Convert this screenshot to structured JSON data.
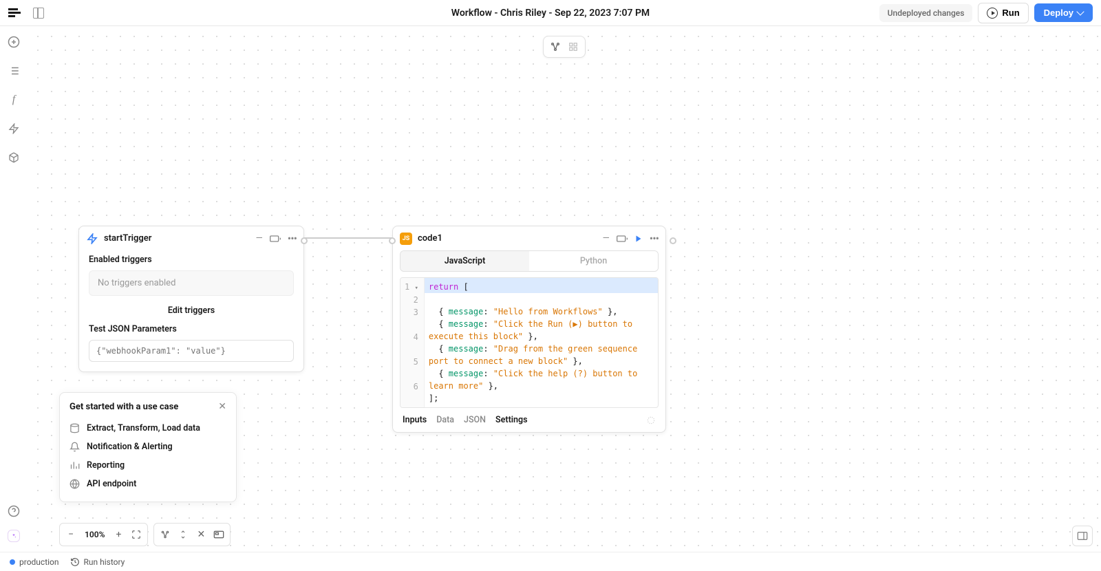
{
  "header": {
    "title": "Workflow - Chris Riley - Sep 22, 2023 7:07 PM",
    "undeployed": "Undeployed changes",
    "run": "Run",
    "deploy": "Deploy"
  },
  "triggerNode": {
    "title": "startTrigger",
    "enabled_label": "Enabled triggers",
    "no_triggers": "No triggers enabled",
    "edit": "Edit triggers",
    "params_label": "Test JSON Parameters",
    "params_placeholder": "{\"webhookParam1\": \"value\"}"
  },
  "codeNode": {
    "title": "code1",
    "tabs": {
      "js": "JavaScript",
      "py": "Python"
    },
    "code_lines": [
      "return [",
      "  { message: \"Hello from Workflows\" },",
      "  { message: \"Click the Run (▶) button to execute this block\" },",
      "  { message: \"Drag from the green sequence port to connect a new block\" },",
      "  { message: \"Click the help (?) button to learn more\" },",
      "];"
    ],
    "footer": {
      "inputs": "Inputs",
      "data": "Data",
      "json": "JSON",
      "settings": "Settings"
    }
  },
  "usecase": {
    "title": "Get started with a use case",
    "items": [
      "Extract, Transform, Load data",
      "Notification & Alerting",
      "Reporting",
      "API endpoint"
    ]
  },
  "zoom": "100%",
  "statusbar": {
    "env": "production",
    "history": "Run history"
  }
}
